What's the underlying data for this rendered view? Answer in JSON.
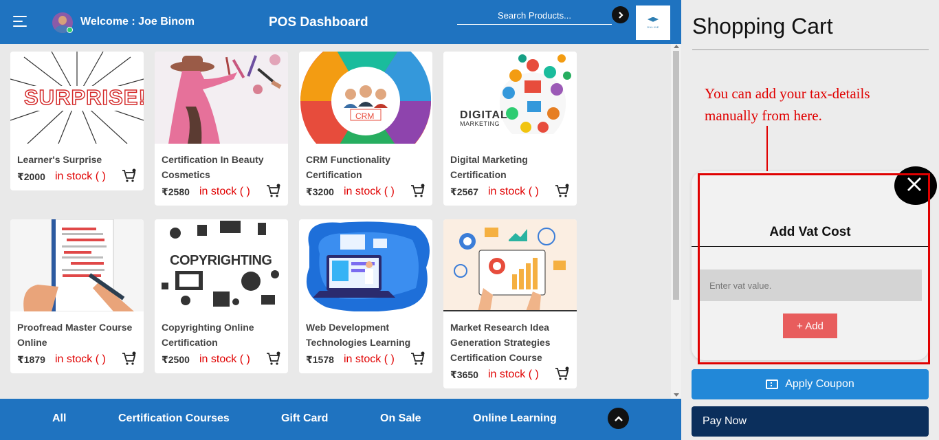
{
  "header": {
    "menu_icon": "hamburger-menu-icon",
    "welcome": "Welcome : Joe Binom",
    "title": "POS Dashboard",
    "search_placeholder": "Search Products...",
    "search_icon": "chevron-right-icon",
    "logo_text": "ONLINE",
    "color": "#1f73c0"
  },
  "products": [
    {
      "name": "Learner's Surprise",
      "price": "₹2000",
      "stock": "in stock ( )"
    },
    {
      "name": "Certification In Beauty Cosmetics",
      "price": "₹2580",
      "stock": "in stock ( )"
    },
    {
      "name": "CRM Functionality Certification",
      "price": "₹3200",
      "stock": "in stock ( )"
    },
    {
      "name": "Digital Marketing Certification",
      "price": "₹2567",
      "stock": "in stock ( )"
    },
    {
      "name": "Proofread Master Course Online",
      "price": "₹1879",
      "stock": "in stock ( )"
    },
    {
      "name": "Copyrighting Online Certification",
      "price": "₹2500",
      "stock": "in stock ( )"
    },
    {
      "name": "Web Development Technologies Learning",
      "price": "₹1578",
      "stock": "in stock ( )"
    },
    {
      "name": "Market Research Idea Generation Strategies Certification Course",
      "price": "₹3650",
      "stock": "in stock ( )"
    }
  ],
  "image_text": {
    "surprise": "SURPRISE!",
    "crm": "CRM",
    "digital": "DIGITAL",
    "marketing": "MARKETING",
    "copyrighting": "COPYRIGHTING"
  },
  "bottom_nav": {
    "items": [
      "All",
      "Certification Courses",
      "Gift Card",
      "On Sale",
      "Online Learning"
    ],
    "scroll_top_icon": "chevron-up-icon"
  },
  "cart": {
    "title": "Shopping Cart",
    "annotation": "You can add your tax-details manually from here.",
    "modal_title": "Add Vat Cost",
    "vat_placeholder": "Enter vat value.",
    "add_label": "+ Add",
    "close_icon": "close-icon",
    "coupon_label": "Apply Coupon",
    "coupon_icon": "ticket-icon",
    "pay_label": "Pay Now"
  },
  "colors": {
    "accent": "#1f73c0",
    "stock_red": "#e00000",
    "add_button": "#e85d5d",
    "coupon_button": "#2288d8",
    "pay_button": "#0b2f5c"
  }
}
